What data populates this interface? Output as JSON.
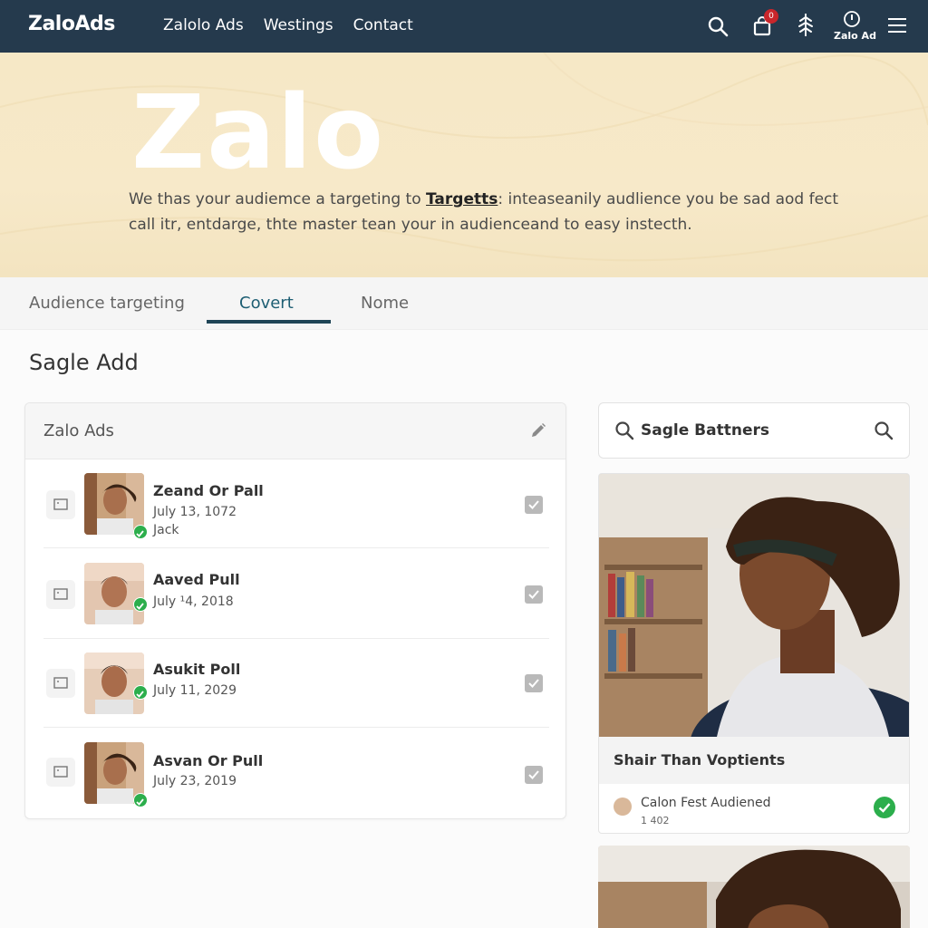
{
  "nav": {
    "brand": "ZaloAds",
    "links": [
      "Zalolo Ads",
      "Westings",
      "Contact"
    ],
    "cart_badge": "0",
    "profile_label": "Zalo Ad",
    "icons": [
      "search-icon",
      "cart-icon",
      "leaf-icon",
      "clock-icon",
      "menu-icon"
    ]
  },
  "hero": {
    "title": "Zalo",
    "text_before": "We thas your audiemce a targeting to ",
    "text_link": "Targetts",
    "text_after": ": inteaseanily audlience you be sad aod fect call itr, entdarge, thte master tean your in audienceand to easy instecth."
  },
  "tabs": [
    {
      "label": "Audience targeting",
      "active": false
    },
    {
      "label": "Covert",
      "active": true
    },
    {
      "label": "Nome",
      "active": false
    }
  ],
  "section_title": "Sagle Add",
  "card": {
    "title": "Zalo Ads",
    "rows": [
      {
        "name": "Zeand Or Pall",
        "date": "July 13, 1072",
        "sub": "Jack",
        "checked": true,
        "verified": true
      },
      {
        "name": "Aaved Pull",
        "date": "July ¹4, 2018",
        "sub": "",
        "checked": true,
        "verified": true
      },
      {
        "name": "Asukit Poll",
        "date": "July 11, 2029",
        "sub": "",
        "checked": true,
        "verified": true
      },
      {
        "name": "Asvan Or Pull",
        "date": "July 23, 2019",
        "sub": "",
        "checked": true,
        "verified": true
      }
    ]
  },
  "search": {
    "label": "Sagle Battners"
  },
  "ad": {
    "title": "Shair Than Voptients",
    "sub": "Calon Fest Audiened",
    "count": "1 402",
    "verified": true
  },
  "colors": {
    "nav_bg": "#253a4d",
    "hero_bg": "#f6e8c6",
    "tab_active": "#1d5e73",
    "verified": "#2cae4c",
    "badge": "#c9262b"
  }
}
